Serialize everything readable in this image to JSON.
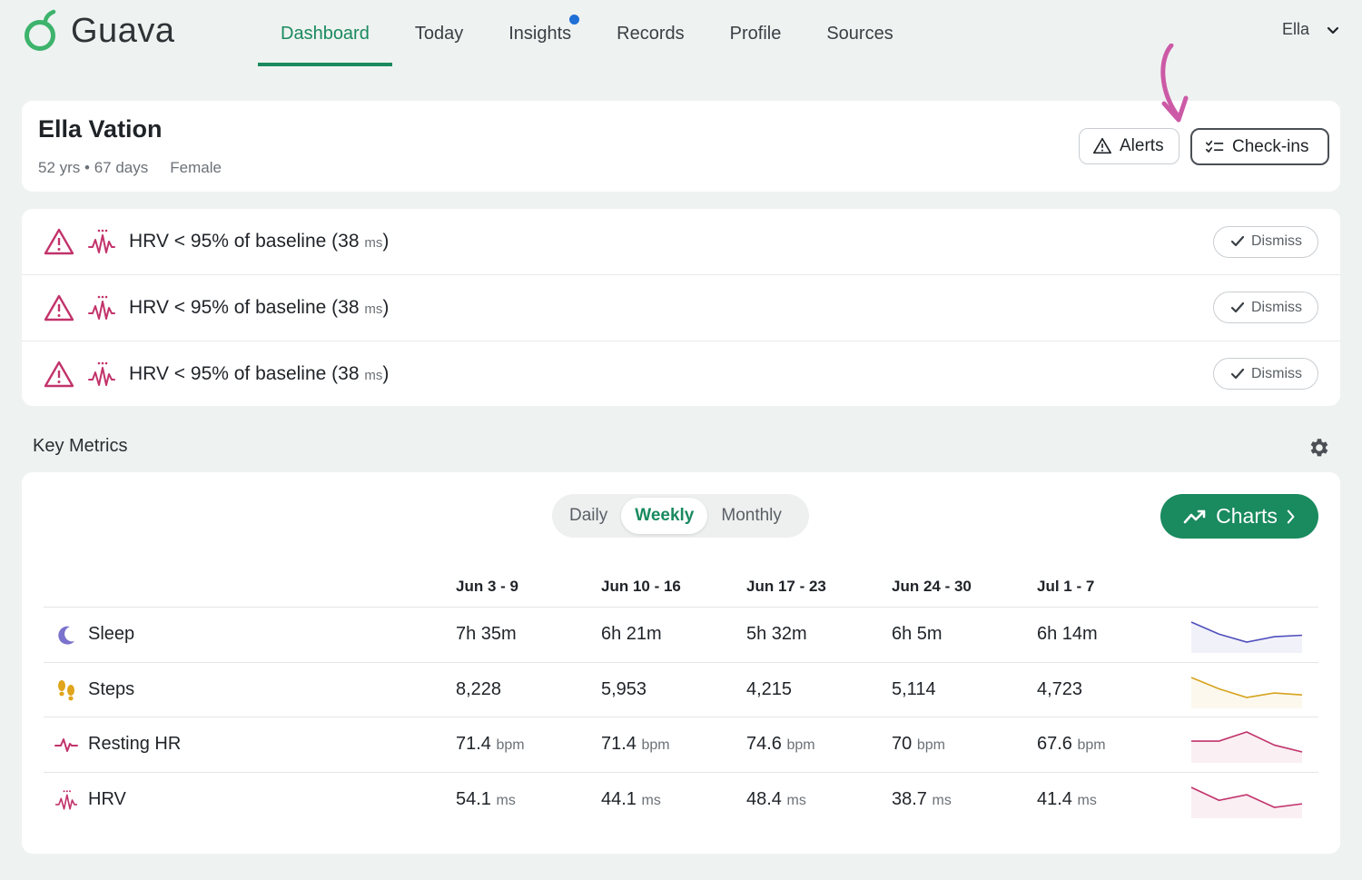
{
  "app": {
    "name": "Guava"
  },
  "nav": {
    "items": [
      {
        "label": "Dashboard",
        "active": true
      },
      {
        "label": "Today"
      },
      {
        "label": "Insights",
        "badge": true
      },
      {
        "label": "Records"
      },
      {
        "label": "Profile"
      },
      {
        "label": "Sources"
      }
    ],
    "user": "Ella"
  },
  "patient": {
    "name": "Ella Vation",
    "age": "52 yrs • 67 days",
    "sex": "Female",
    "alerts_label": "Alerts",
    "checkins_label": "Check-ins"
  },
  "alerts": [
    {
      "prefix": "HRV < 95% of baseline (38 ",
      "unit": "ms",
      "suffix": ")",
      "action": "Dismiss"
    },
    {
      "prefix": "HRV < 95% of baseline (38 ",
      "unit": "ms",
      "suffix": ")",
      "action": "Dismiss"
    },
    {
      "prefix": "HRV < 95% of baseline (38 ",
      "unit": "ms",
      "suffix": ")",
      "action": "Dismiss"
    }
  ],
  "metrics": {
    "title": "Key Metrics",
    "periods": [
      "Daily",
      "Weekly",
      "Monthly"
    ],
    "active_period": "Weekly",
    "charts_label": "Charts",
    "columns": [
      "Jun 3 - 9",
      "Jun 10 - 16",
      "Jun 17 - 23",
      "Jun 24 - 30",
      "Jul 1 - 7"
    ],
    "rows": [
      {
        "label": "Sleep",
        "icon": "moon-icon",
        "color": "#4f4fbd",
        "values": [
          {
            "v": "7h 35m",
            "u": ""
          },
          {
            "v": "6h 21m",
            "u": ""
          },
          {
            "v": "5h 32m",
            "u": ""
          },
          {
            "v": "6h 5m",
            "u": ""
          },
          {
            "v": "6h 14m",
            "u": ""
          }
        ],
        "trend": [
          455,
          381,
          332,
          365,
          374
        ]
      },
      {
        "label": "Steps",
        "icon": "footprints-icon",
        "color": "#d6a31d",
        "values": [
          {
            "v": "8,228",
            "u": ""
          },
          {
            "v": "5,953",
            "u": ""
          },
          {
            "v": "4,215",
            "u": ""
          },
          {
            "v": "5,114",
            "u": ""
          },
          {
            "v": "4,723",
            "u": ""
          }
        ],
        "trend": [
          8228,
          5953,
          4215,
          5114,
          4723
        ]
      },
      {
        "label": "Resting HR",
        "icon": "heartbeat-icon",
        "color": "#c2336b",
        "values": [
          {
            "v": "71.4",
            "u": "bpm"
          },
          {
            "v": "71.4",
            "u": "bpm"
          },
          {
            "v": "74.6",
            "u": "bpm"
          },
          {
            "v": "70",
            "u": "bpm"
          },
          {
            "v": "67.6",
            "u": "bpm"
          }
        ],
        "trend": [
          71.4,
          71.4,
          74.6,
          70,
          67.6
        ]
      },
      {
        "label": "HRV",
        "icon": "hrv-icon",
        "color": "#c2336b",
        "values": [
          {
            "v": "54.1",
            "u": "ms"
          },
          {
            "v": "44.1",
            "u": "ms"
          },
          {
            "v": "48.4",
            "u": "ms"
          },
          {
            "v": "38.7",
            "u": "ms"
          },
          {
            "v": "41.4",
            "u": "ms"
          }
        ],
        "trend": [
          54.1,
          44.1,
          48.4,
          38.7,
          41.4
        ]
      }
    ]
  },
  "colors": {
    "brand": "#1a8a5f",
    "alert": "#c2336b",
    "badge": "#1f6fd6",
    "annotation": "#cc5aa6"
  }
}
